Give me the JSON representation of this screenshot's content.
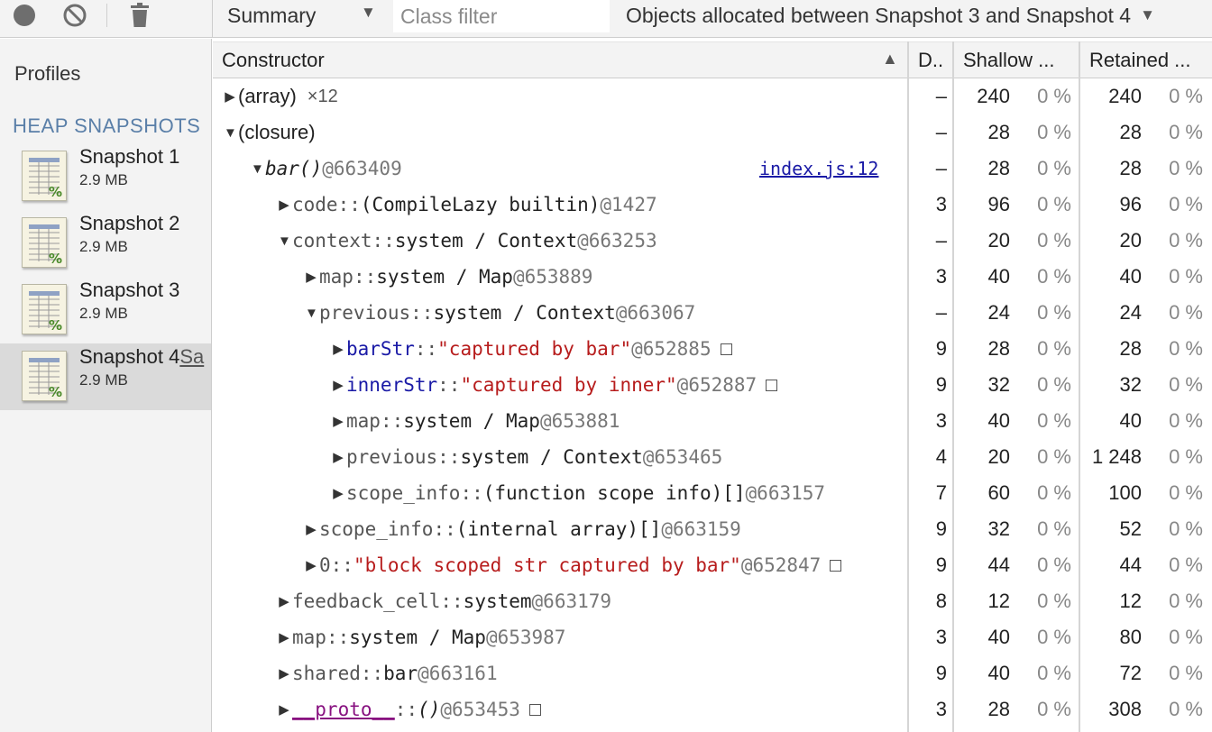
{
  "toolbar": {
    "record_icon": "record-icon",
    "clear_icon": "clear-icon",
    "trash_icon": "trash-icon",
    "view": "Summary",
    "class_filter_placeholder": "Class filter",
    "range": "Objects allocated between Snapshot 3 and Snapshot 4"
  },
  "sidebar": {
    "title": "Profiles",
    "section": "HEAP SNAPSHOTS",
    "snapshots": [
      {
        "name": "Snapshot 1",
        "size": "2.9 MB"
      },
      {
        "name": "Snapshot 2",
        "size": "2.9 MB"
      },
      {
        "name": "Snapshot 3",
        "size": "2.9 MB"
      },
      {
        "name": "Snapshot 4",
        "edit": "Sa",
        "size": "2.9 MB",
        "selected": true
      }
    ]
  },
  "grid": {
    "headers": {
      "constructor": "Constructor",
      "distance": "D..",
      "shallow": "Shallow ...",
      "retained": "Retained ..."
    },
    "rows": [
      {
        "depth": 0,
        "open": false,
        "parts": [
          {
            "t": "(array)",
            "c": "plain"
          }
        ],
        "count": "×12",
        "distance": "–",
        "shallow": "240",
        "shallow_pct": "0 %",
        "retained": "240",
        "retained_pct": "0 %"
      },
      {
        "depth": 0,
        "open": true,
        "parts": [
          {
            "t": "(closure)",
            "c": "plain"
          }
        ],
        "distance": "–",
        "shallow": "28",
        "shallow_pct": "0 %",
        "retained": "28",
        "retained_pct": "0 %"
      },
      {
        "depth": 1,
        "open": true,
        "parts": [
          {
            "t": "bar()",
            "c": "c-type c-italic"
          },
          {
            "t": " @663409",
            "c": "c-id"
          }
        ],
        "link": "index.js:12",
        "distance": "–",
        "shallow": "28",
        "shallow_pct": "0 %",
        "retained": "28",
        "retained_pct": "0 %"
      },
      {
        "depth": 2,
        "open": false,
        "parts": [
          {
            "t": "code",
            "c": "c-prop"
          },
          {
            "t": " :: ",
            "c": "c-sep"
          },
          {
            "t": "(CompileLazy builtin)",
            "c": "c-type"
          },
          {
            "t": " @1427",
            "c": "c-id"
          }
        ],
        "distance": "3",
        "shallow": "96",
        "shallow_pct": "0 %",
        "retained": "96",
        "retained_pct": "0 %"
      },
      {
        "depth": 2,
        "open": true,
        "parts": [
          {
            "t": "context",
            "c": "c-prop"
          },
          {
            "t": " :: ",
            "c": "c-sep"
          },
          {
            "t": "system / Context",
            "c": "c-type"
          },
          {
            "t": " @663253",
            "c": "c-id"
          }
        ],
        "distance": "–",
        "shallow": "20",
        "shallow_pct": "0 %",
        "retained": "20",
        "retained_pct": "0 %"
      },
      {
        "depth": 3,
        "open": false,
        "parts": [
          {
            "t": "map",
            "c": "c-prop"
          },
          {
            "t": " :: ",
            "c": "c-sep"
          },
          {
            "t": "system / Map",
            "c": "c-type"
          },
          {
            "t": " @653889",
            "c": "c-id"
          }
        ],
        "distance": "3",
        "shallow": "40",
        "shallow_pct": "0 %",
        "retained": "40",
        "retained_pct": "0 %"
      },
      {
        "depth": 3,
        "open": true,
        "parts": [
          {
            "t": "previous",
            "c": "c-prop"
          },
          {
            "t": " :: ",
            "c": "c-sep"
          },
          {
            "t": "system / Context",
            "c": "c-type"
          },
          {
            "t": " @663067",
            "c": "c-id"
          }
        ],
        "distance": "–",
        "shallow": "24",
        "shallow_pct": "0 %",
        "retained": "24",
        "retained_pct": "0 %"
      },
      {
        "depth": 4,
        "open": false,
        "parts": [
          {
            "t": "barStr",
            "c": "c-blue"
          },
          {
            "t": " :: ",
            "c": "c-sep"
          },
          {
            "t": "\"captured by bar\"",
            "c": "c-str"
          },
          {
            "t": " @652885",
            "c": "c-id"
          }
        ],
        "box": true,
        "distance": "9",
        "shallow": "28",
        "shallow_pct": "0 %",
        "retained": "28",
        "retained_pct": "0 %"
      },
      {
        "depth": 4,
        "open": false,
        "parts": [
          {
            "t": "innerStr",
            "c": "c-blue"
          },
          {
            "t": " :: ",
            "c": "c-sep"
          },
          {
            "t": "\"captured by inner\"",
            "c": "c-str"
          },
          {
            "t": " @652887",
            "c": "c-id"
          }
        ],
        "box": true,
        "distance": "9",
        "shallow": "32",
        "shallow_pct": "0 %",
        "retained": "32",
        "retained_pct": "0 %"
      },
      {
        "depth": 4,
        "open": false,
        "parts": [
          {
            "t": "map",
            "c": "c-prop"
          },
          {
            "t": " :: ",
            "c": "c-sep"
          },
          {
            "t": "system / Map",
            "c": "c-type"
          },
          {
            "t": " @653881",
            "c": "c-id"
          }
        ],
        "distance": "3",
        "shallow": "40",
        "shallow_pct": "0 %",
        "retained": "40",
        "retained_pct": "0 %"
      },
      {
        "depth": 4,
        "open": false,
        "parts": [
          {
            "t": "previous",
            "c": "c-prop"
          },
          {
            "t": " :: ",
            "c": "c-sep"
          },
          {
            "t": "system / Context",
            "c": "c-type"
          },
          {
            "t": " @653465",
            "c": "c-id"
          }
        ],
        "distance": "4",
        "shallow": "20",
        "shallow_pct": "0 %",
        "retained": "1 248",
        "retained_pct": "0 %"
      },
      {
        "depth": 4,
        "open": false,
        "parts": [
          {
            "t": "scope_info",
            "c": "c-prop"
          },
          {
            "t": " :: ",
            "c": "c-sep"
          },
          {
            "t": "(function scope info)[]",
            "c": "c-type"
          },
          {
            "t": " @663157",
            "c": "c-id"
          }
        ],
        "distance": "7",
        "shallow": "60",
        "shallow_pct": "0 %",
        "retained": "100",
        "retained_pct": "0 %"
      },
      {
        "depth": 3,
        "open": false,
        "parts": [
          {
            "t": "scope_info",
            "c": "c-prop"
          },
          {
            "t": " :: ",
            "c": "c-sep"
          },
          {
            "t": "(internal array)[]",
            "c": "c-type"
          },
          {
            "t": " @663159",
            "c": "c-id"
          }
        ],
        "distance": "9",
        "shallow": "32",
        "shallow_pct": "0 %",
        "retained": "52",
        "retained_pct": "0 %"
      },
      {
        "depth": 3,
        "open": false,
        "parts": [
          {
            "t": "0",
            "c": "c-prop"
          },
          {
            "t": " :: ",
            "c": "c-sep"
          },
          {
            "t": "\"block scoped str captured by bar\"",
            "c": "c-str"
          },
          {
            "t": " @652847",
            "c": "c-id"
          }
        ],
        "box": true,
        "distance": "9",
        "shallow": "44",
        "shallow_pct": "0 %",
        "retained": "44",
        "retained_pct": "0 %"
      },
      {
        "depth": 2,
        "open": false,
        "parts": [
          {
            "t": "feedback_cell",
            "c": "c-prop"
          },
          {
            "t": " :: ",
            "c": "c-sep"
          },
          {
            "t": "system",
            "c": "c-type"
          },
          {
            "t": " @663179",
            "c": "c-id"
          }
        ],
        "distance": "8",
        "shallow": "12",
        "shallow_pct": "0 %",
        "retained": "12",
        "retained_pct": "0 %"
      },
      {
        "depth": 2,
        "open": false,
        "parts": [
          {
            "t": "map",
            "c": "c-prop"
          },
          {
            "t": " :: ",
            "c": "c-sep"
          },
          {
            "t": "system / Map",
            "c": "c-type"
          },
          {
            "t": " @653987",
            "c": "c-id"
          }
        ],
        "distance": "3",
        "shallow": "40",
        "shallow_pct": "0 %",
        "retained": "80",
        "retained_pct": "0 %"
      },
      {
        "depth": 2,
        "open": false,
        "parts": [
          {
            "t": "shared",
            "c": "c-prop"
          },
          {
            "t": " :: ",
            "c": "c-sep"
          },
          {
            "t": "bar",
            "c": "c-type"
          },
          {
            "t": " @663161",
            "c": "c-id"
          }
        ],
        "distance": "9",
        "shallow": "40",
        "shallow_pct": "0 %",
        "retained": "72",
        "retained_pct": "0 %"
      },
      {
        "depth": 2,
        "open": false,
        "parts": [
          {
            "t": "__proto__",
            "c": "c-purple"
          },
          {
            "t": " :: ",
            "c": "c-sep"
          },
          {
            "t": "()",
            "c": "c-type c-italic"
          },
          {
            "t": " @653453",
            "c": "c-id"
          }
        ],
        "box": true,
        "distance": "3",
        "shallow": "28",
        "shallow_pct": "0 %",
        "retained": "308",
        "retained_pct": "0 %"
      }
    ]
  }
}
